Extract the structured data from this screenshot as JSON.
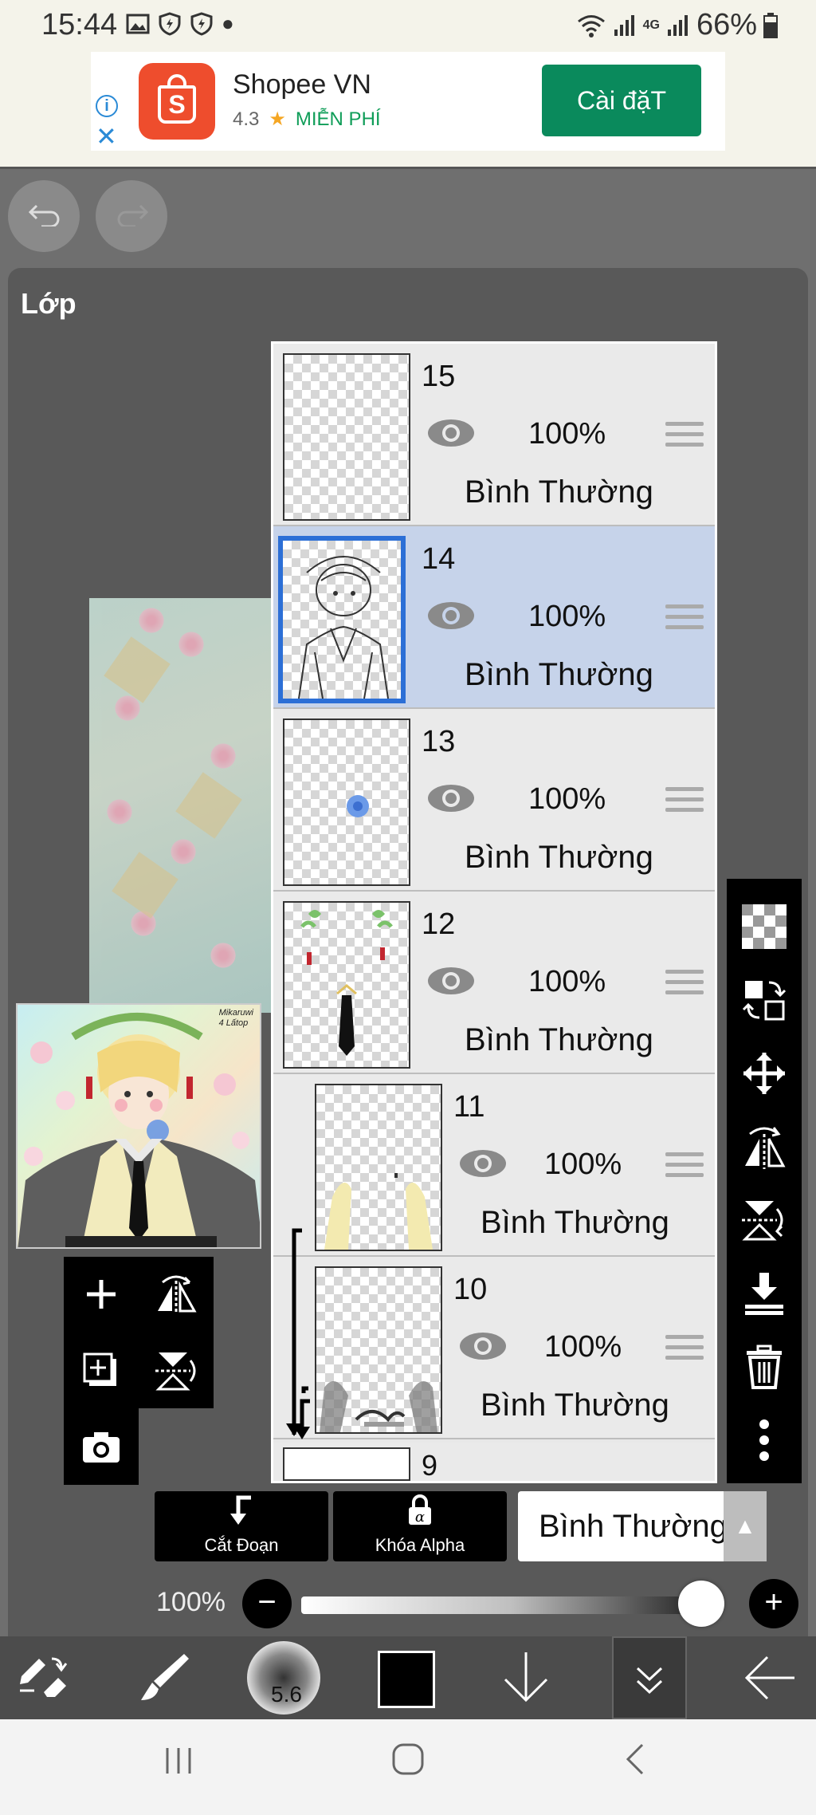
{
  "status_bar": {
    "time": "15:44",
    "network": "4G",
    "battery": "66%"
  },
  "ad": {
    "app_name": "Shopee VN",
    "rating": "4.3",
    "price": "MIỄN PHÍ",
    "install_label": "Cài đặT",
    "logo_letter": "S"
  },
  "panel": {
    "title": "Lớp"
  },
  "thumbnail": {
    "signature_line1": "Mikaruwi",
    "signature_line2": "4 Lấtop"
  },
  "layers": [
    {
      "number": "15",
      "opacity": "100%",
      "mode": "Bình Thường",
      "selected": false,
      "clipped": false
    },
    {
      "number": "14",
      "opacity": "100%",
      "mode": "Bình Thường",
      "selected": true,
      "clipped": false
    },
    {
      "number": "13",
      "opacity": "100%",
      "mode": "Bình Thường",
      "selected": false,
      "clipped": false
    },
    {
      "number": "12",
      "opacity": "100%",
      "mode": "Bình Thường",
      "selected": false,
      "clipped": false
    },
    {
      "number": "11",
      "opacity": "100%",
      "mode": "Bình Thường",
      "selected": false,
      "clipped": true
    },
    {
      "number": "10",
      "opacity": "100%",
      "mode": "Bình Thường",
      "selected": false,
      "clipped": true
    }
  ],
  "peek_layer": {
    "number": "9"
  },
  "bottom_controls": {
    "clip_label": "Cắt Đoạn",
    "alpha_lock_label": "Khóa Alpha",
    "blend_mode": "Bình Thường",
    "opacity_label": "100%",
    "opacity_value": 0.95
  },
  "brush_size": "5.6",
  "colors": {
    "primary": "#000000",
    "accent_selected": "#2c6fd6",
    "selected_row": "#c6d3ea",
    "install_button": "#0a8a5c",
    "shopee": "#ee4d2d"
  }
}
